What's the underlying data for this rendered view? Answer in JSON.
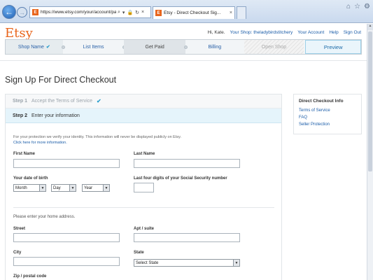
{
  "browser": {
    "url": "https://www.etsy.com/your/account/payment",
    "favicon": "E",
    "tab_title": "Etsy - Direct Checkout Sig...",
    "tab_close": "×",
    "addr_icons": [
      "⌕",
      "▾",
      "🔒",
      "↻",
      "×"
    ],
    "right_icons": [
      "⌂",
      "☆",
      "⚙"
    ]
  },
  "header": {
    "logo": "Etsy",
    "greeting": "Hi, Kate.",
    "links": [
      "Your Shop: theladybirdstitchery",
      "Your Account",
      "Help",
      "Sign Out"
    ]
  },
  "steps": {
    "shop_name": "Shop Name",
    "shop_name_check": "✔",
    "list_items": "List Items",
    "get_paid": "Get Paid",
    "billing": "Billing",
    "open_shop": "Open Shop",
    "preview": "Preview"
  },
  "page_title": "Sign Up For Direct Checkout",
  "form": {
    "step1_num": "Step 1",
    "step1_text": "Accept the Terms of Service",
    "step1_check": "✔",
    "step2_num": "Step 2",
    "step2_text": "Enter your information",
    "note": "For your protection we verify your identity. This information will never be displayed publicly on Etsy.",
    "note_link": "Click here for more information.",
    "first_name": "First Name",
    "last_name": "Last Name",
    "dob": "Your date of birth",
    "ssn": "Last four digits of your Social Security number",
    "month": "Month",
    "day": "Day",
    "year": "Year",
    "address_note": "Please enter your home address.",
    "street": "Street",
    "apt": "Apt / suite",
    "city": "City",
    "state": "State",
    "state_value": "Select State",
    "zip": "Zip / postal code"
  },
  "side": {
    "title": "Direct Checkout Info",
    "links": [
      "Terms of Service",
      "FAQ",
      "Seller Protection"
    ]
  },
  "colors": {
    "brand": "#e8651c",
    "link": "#1a5ca8",
    "step2_bg": "#e5f4fb"
  }
}
